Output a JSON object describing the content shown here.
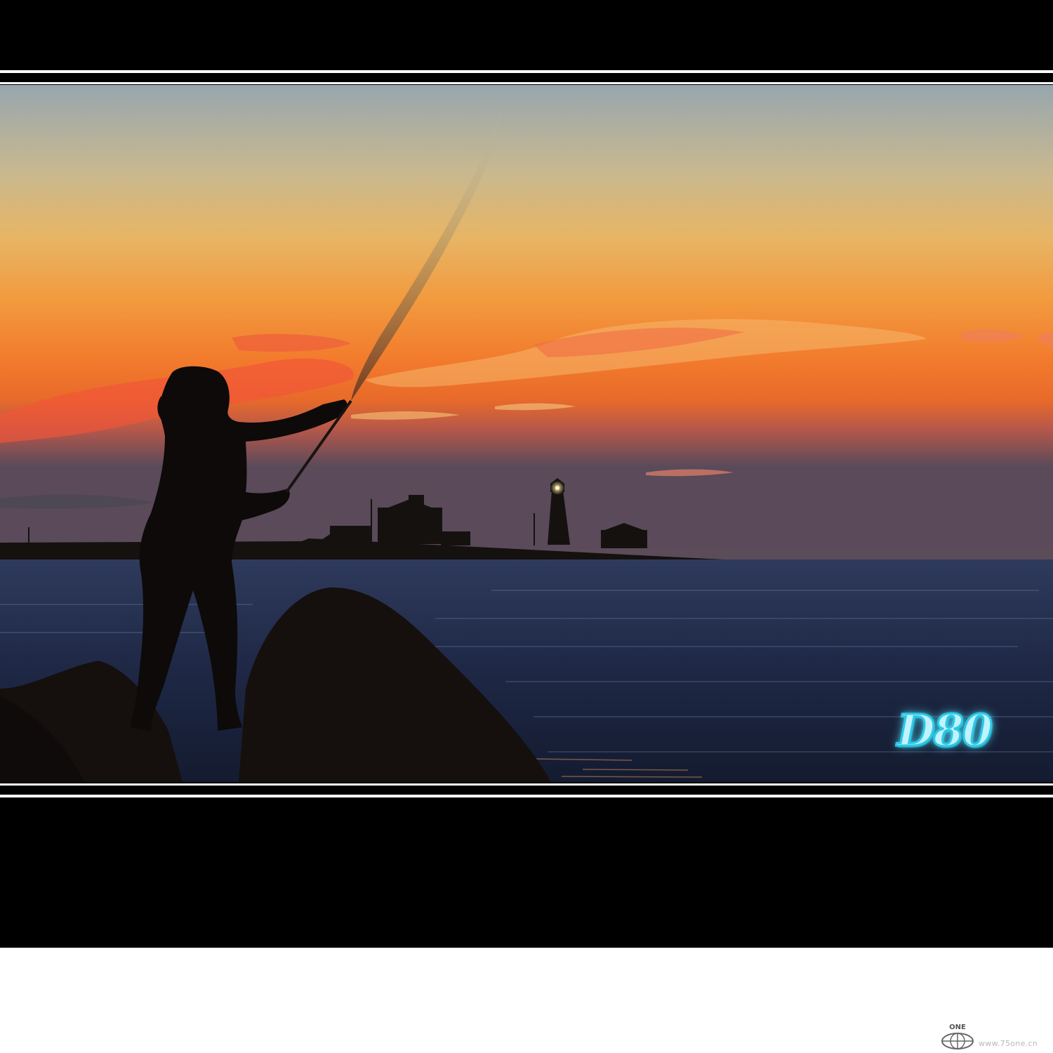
{
  "watermark": {
    "text": "D80",
    "color": "#3fd6f0"
  },
  "site": {
    "logo_text": "ONE",
    "url": "www.75one.cn"
  },
  "colors": {
    "frame": "#000000",
    "sky_top": "#9aa7ad",
    "sky_mid": "#e9a44a",
    "sky_low": "#f06a2a",
    "sea": "#1c2640"
  },
  "icons": [
    "globe-logo-icon"
  ]
}
